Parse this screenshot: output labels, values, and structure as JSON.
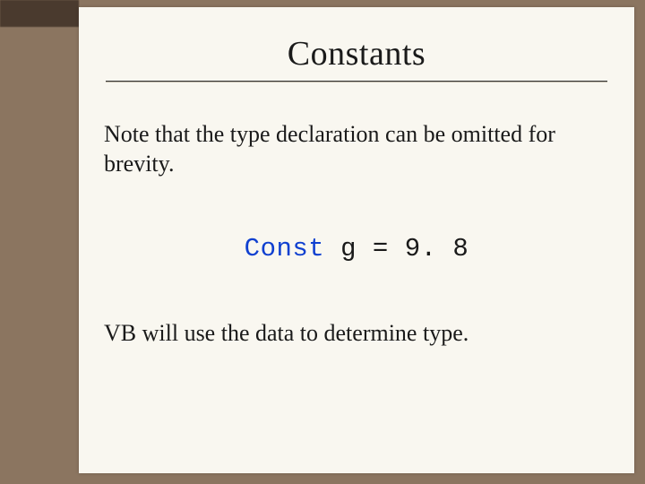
{
  "title": "Constants",
  "body": {
    "line1": "Note that the type declaration can be omitted for brevity.",
    "line2": "VB will use the data to determine type."
  },
  "code": {
    "keyword": "Const",
    "rest": " g = 9. 8"
  }
}
